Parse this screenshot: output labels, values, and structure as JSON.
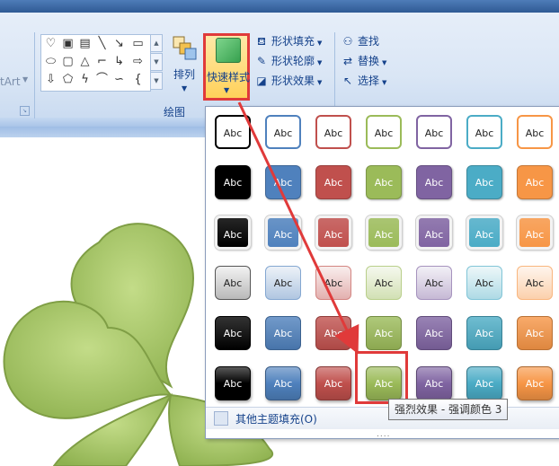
{
  "ribbon": {
    "smartart_stub": "tArt",
    "arrange_label": "排列",
    "quick_styles_label": "快速样式",
    "group_label_drawing": "绘图",
    "commands": {
      "shape_fill": "形状填充",
      "shape_outline": "形状轮廓",
      "shape_effects": "形状效果",
      "find": "查找",
      "replace": "替换",
      "select": "选择"
    }
  },
  "gallery": {
    "cell_text": "Abc",
    "theme_colors": [
      "#000000",
      "#4f81bd",
      "#c0504d",
      "#9bbb59",
      "#8064a2",
      "#4bacc6",
      "#f79646"
    ],
    "rows": [
      "outline",
      "solid-fill",
      "bevel",
      "light-gradient",
      "moderate-gradient",
      "intense-effect"
    ],
    "selected": {
      "row": 6,
      "column": 4
    },
    "footer_label": "其他主题填充(O)",
    "tooltip": "强烈效果 - 强调颜色 3"
  },
  "colors": {
    "highlight": "#e03a3a",
    "ribbon": "#dae6f5",
    "clover": "#9bbb59"
  }
}
